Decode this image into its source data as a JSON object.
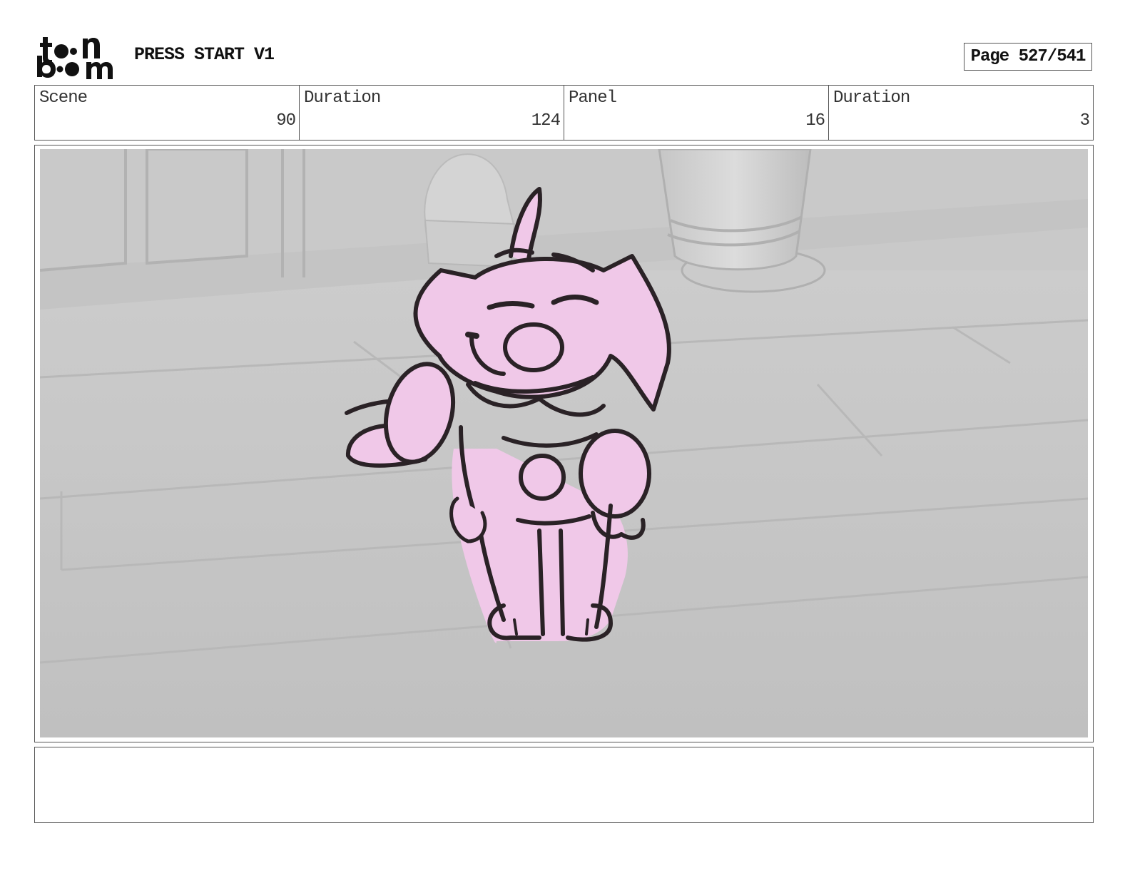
{
  "header": {
    "logo_top": "t o n",
    "logo_bottom": "b o m",
    "project_title": "PRESS START V1",
    "page_label": "Page 527/541"
  },
  "info": {
    "scene_label": "Scene",
    "scene_value": "90",
    "scene_duration_label": "Duration",
    "scene_duration_value": "124",
    "panel_label": "Panel",
    "panel_value": "16",
    "panel_duration_label": "Duration",
    "panel_duration_value": "3"
  },
  "panel": {
    "description": "",
    "colors": {
      "background": "#c7c7c7",
      "character_fill": "#f0c8e8",
      "line": "#2a2226"
    }
  },
  "notes": {
    "text": ""
  }
}
